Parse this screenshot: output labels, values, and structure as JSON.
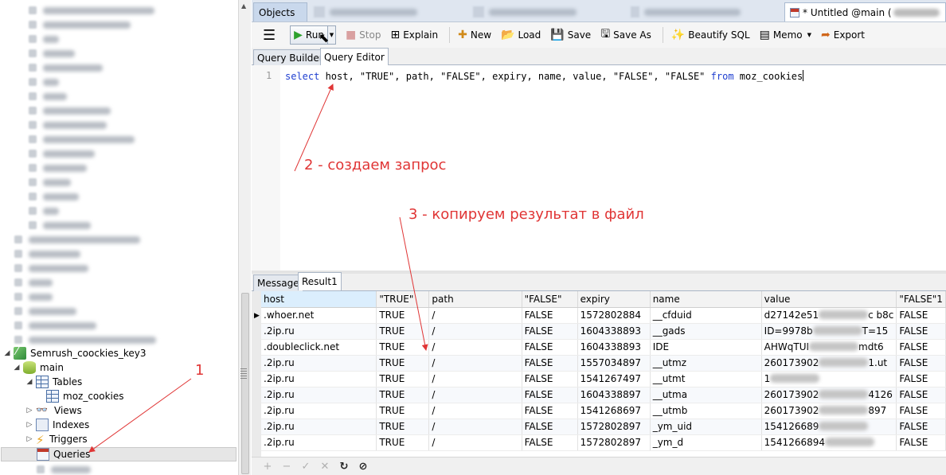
{
  "navigator": {
    "connection": "Semrush_coockies_key3",
    "database": "main",
    "tables_label": "Tables",
    "table_name": "moz_cookies",
    "views_label": "Views",
    "indexes_label": "Indexes",
    "triggers_label": "Triggers",
    "queries_label": "Queries",
    "expander_open": "◢",
    "expander_closed": "▷"
  },
  "tabs": {
    "objects": "Objects",
    "untitled": "* Untitled @main ("
  },
  "toolbar": {
    "menu": "☰",
    "run": "Run",
    "stop": "Stop",
    "explain": "Explain",
    "new": "New",
    "load": "Load",
    "save": "Save",
    "save_as": "Save As",
    "beautify": "Beautify SQL",
    "memo": "Memo",
    "export": "Export",
    "icons": {
      "run": "▶",
      "stop": "■",
      "explain": "⊞",
      "new": "✚",
      "load": "📂",
      "save": "💾",
      "save_as": "🖫",
      "beautify": "✨",
      "memo": "▤",
      "export": "➦",
      "dropdown": "▼"
    }
  },
  "subtabs": {
    "query_builder": "Query Builder",
    "query_editor": "Query Editor"
  },
  "editor": {
    "line_number": "1",
    "kw_select": "select",
    "columns": " host, \"TRUE\", path, \"FALSE\", expiry, name, value, \"FALSE\", \"FALSE\" ",
    "kw_from": "from",
    "table": " moz_cookies"
  },
  "annotations": {
    "step1": "1",
    "step2": "2  - создаем запрос",
    "step3": "3 - копируем результат в файл"
  },
  "result_tabs": {
    "message": "Message",
    "result1": "Result1"
  },
  "grid": {
    "columns": [
      "host",
      "\"TRUE\"",
      "path",
      "\"FALSE\"",
      "expiry",
      "name",
      "value",
      "\"FALSE\"1"
    ],
    "rows": [
      [
        ".whoer.net",
        "TRUE",
        "/",
        "FALSE",
        "1572802884",
        "__cfduid",
        "d27142e51",
        "FALSE"
      ],
      [
        ".2ip.ru",
        "TRUE",
        "/",
        "FALSE",
        "1604338893",
        "__gads",
        "ID=9978b",
        "FALSE"
      ],
      [
        ".doubleclick.net",
        "TRUE",
        "/",
        "FALSE",
        "1604338893",
        "IDE",
        "AHWqTUI",
        "FALSE"
      ],
      [
        ".2ip.ru",
        "TRUE",
        "/",
        "FALSE",
        "1557034897",
        "__utmz",
        "260173902",
        "FALSE"
      ],
      [
        ".2ip.ru",
        "TRUE",
        "/",
        "FALSE",
        "1541267497",
        "__utmt",
        "1",
        "FALSE"
      ],
      [
        ".2ip.ru",
        "TRUE",
        "/",
        "FALSE",
        "1604338897",
        "__utma",
        "260173902",
        "FALSE"
      ],
      [
        ".2ip.ru",
        "TRUE",
        "/",
        "FALSE",
        "1541268697",
        "__utmb",
        "260173902",
        "FALSE"
      ],
      [
        ".2ip.ru",
        "TRUE",
        "/",
        "FALSE",
        "1572802897",
        "_ym_uid",
        "154126689",
        "FALSE"
      ],
      [
        ".2ip.ru",
        "TRUE",
        "/",
        "FALSE",
        "1572802897",
        "_ym_d",
        "1541266894",
        "FALSE"
      ]
    ],
    "value_suffixes": [
      "c b8c",
      "T=15",
      "mdt6",
      "1.ut",
      "",
      "4126",
      "897",
      "",
      ""
    ]
  },
  "grid_footer": {
    "add": "+",
    "remove": "−",
    "apply": "✓",
    "discard": "✕",
    "refresh": "↻",
    "stop": "⊘"
  },
  "colors": {
    "keyword": "#1f3fd0",
    "annotation": "#e03535",
    "run_green": "#2ea12e"
  }
}
